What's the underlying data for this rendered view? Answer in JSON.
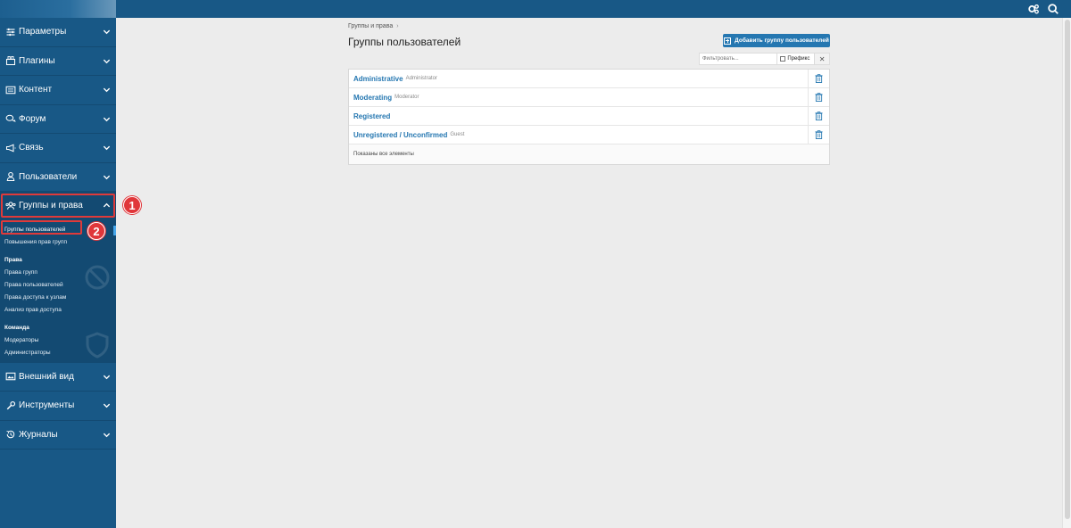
{
  "sidebar": {
    "items_top": [
      {
        "label": "Параметры",
        "icon": "sliders-icon"
      },
      {
        "label": "Плагины",
        "icon": "plugin-icon"
      },
      {
        "label": "Контент",
        "icon": "content-icon"
      },
      {
        "label": "Форум",
        "icon": "forum-icon"
      },
      {
        "label": "Связь",
        "icon": "megaphone-icon"
      },
      {
        "label": "Пользователи",
        "icon": "user-icon"
      }
    ],
    "active_item": {
      "label": "Группы и права",
      "icon": "users-group-icon",
      "expanded": true
    },
    "subnav": {
      "links_a": [
        "Группы пользователей",
        "Повышения прав групп"
      ],
      "selected_link": "Группы пользователей",
      "heading_b": "Права",
      "links_b": [
        "Права групп",
        "Права пользователей",
        "Права доступа к узлам",
        "Анализ прав доступа"
      ],
      "heading_c": "Команда",
      "links_c": [
        "Модераторы",
        "Администраторы"
      ]
    },
    "items_bottom": [
      {
        "label": "Внешний вид",
        "icon": "appearance-icon"
      },
      {
        "label": "Инструменты",
        "icon": "wrench-icon"
      },
      {
        "label": "Журналы",
        "icon": "history-icon"
      }
    ]
  },
  "annotations": {
    "badge_1": "1",
    "badge_2": "2"
  },
  "main": {
    "breadcrumb": "Группы и права",
    "breadcrumb_sep": "›",
    "title": "Группы пользователей",
    "add_button": "Добавить группу пользователей",
    "filter": {
      "placeholder": "Фильтровать...",
      "prefix_label": "Префикс",
      "clear": "✕"
    },
    "groups": [
      {
        "title": "Administrative",
        "subtitle": "Administrator"
      },
      {
        "title": "Moderating",
        "subtitle": "Moderator"
      },
      {
        "title": "Registered",
        "subtitle": ""
      },
      {
        "title": "Unregistered / Unconfirmed",
        "subtitle": "Guest"
      }
    ],
    "footer": "Показаны все элементы"
  },
  "colors": {
    "sidebar": "#185886",
    "sidebar_dark": "#134a72",
    "accent": "#2577b1",
    "badge": "#e0363a"
  }
}
